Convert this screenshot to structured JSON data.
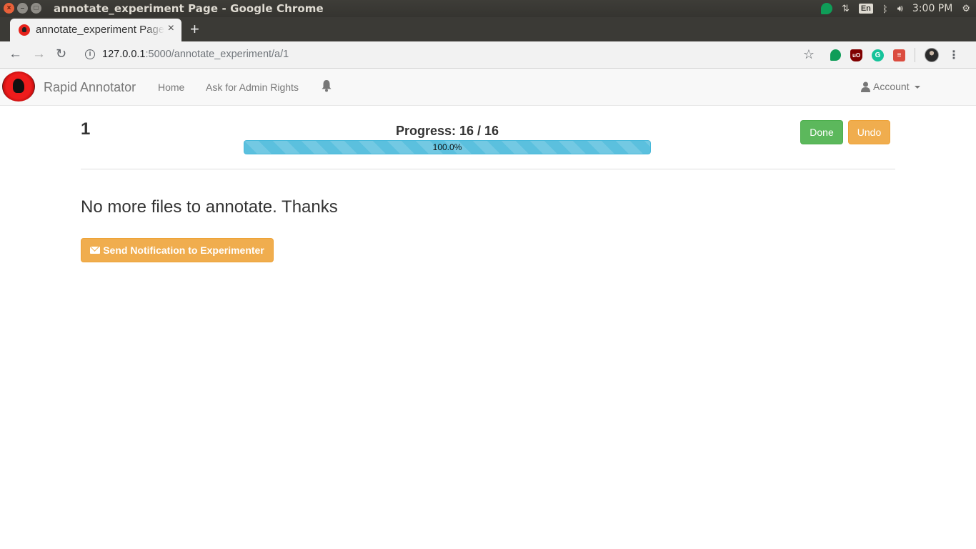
{
  "os": {
    "window_title": "annotate_experiment Page - Google Chrome",
    "close_glyph": "×",
    "minimize_glyph": "–",
    "maximize_glyph": "□",
    "lang": "En",
    "time": "3:00 PM"
  },
  "browser": {
    "tab_title": "annotate_experiment Page",
    "tab_close": "×",
    "new_tab": "+",
    "url_host": "127.0.0.1",
    "url_path": ":5000/annotate_experiment/a/1",
    "back_glyph": "←",
    "forward_glyph": "→",
    "reload_glyph": "↻",
    "star_glyph": "☆",
    "info_glyph": "i",
    "menu_glyph": "⋮",
    "extensions": [
      "hangouts-icon",
      "ublock-icon",
      "grammarly-icon",
      "todoist-icon",
      "profile-avatar"
    ],
    "ext_labels": {
      "ublock": "uO",
      "grammarly": "G",
      "todoist": "≡"
    }
  },
  "navbar": {
    "brand": "Rapid Annotator",
    "links": [
      "Home",
      "Ask for Admin Rights"
    ],
    "account": "Account"
  },
  "main": {
    "experiment_number": "1",
    "progress_label": "Progress: 16 / 16",
    "progress_text": "100.0%",
    "progress_value": 1.0,
    "done_label": "Done",
    "undo_label": "Undo",
    "message": "No more files to annotate. Thanks",
    "notify_label": "Send Notification to Experimenter"
  },
  "colors": {
    "success": "#5cb85c",
    "warning": "#f0ad4e",
    "info": "#5bc0de",
    "brand_red": "#ee1c1c"
  }
}
